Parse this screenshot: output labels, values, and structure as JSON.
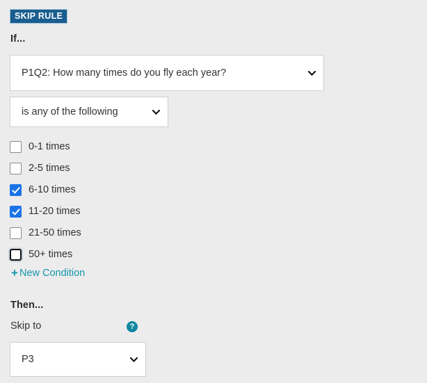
{
  "badge": {
    "label": "SKIP RULE",
    "bg_color": "#1a5e8f",
    "text_color": "#ffffff"
  },
  "if_section": {
    "heading": "If...",
    "question_select": {
      "value": "P1Q2: How many times do you fly each year?",
      "chevron_icon": "chevron-down-icon"
    },
    "operator_select": {
      "value": "is any of the following",
      "chevron_icon": "chevron-down-icon"
    },
    "choices": [
      {
        "label": "0-1 times",
        "checked": false,
        "focused": false
      },
      {
        "label": "2-5 times",
        "checked": false,
        "focused": false
      },
      {
        "label": "6-10 times",
        "checked": true,
        "focused": false
      },
      {
        "label": "11-20 times",
        "checked": true,
        "focused": false
      },
      {
        "label": "21-50 times",
        "checked": false,
        "focused": false
      },
      {
        "label": "50+ times",
        "checked": false,
        "focused": true
      }
    ],
    "new_condition": {
      "label": "New Condition",
      "plus_icon": "plus-icon",
      "color": "#1597ad"
    }
  },
  "then_section": {
    "heading": "Then...",
    "skip_to_label": "Skip to",
    "help_icon": {
      "glyph": "?",
      "name": "help-circle-icon",
      "color": "#10889e"
    },
    "skipto_select": {
      "value": "P3",
      "chevron_icon": "chevron-down-icon"
    }
  },
  "theme": {
    "page_background": "#ececec",
    "checkbox_checked_color": "#1a73e8",
    "link_color": "#1597ad",
    "text_color": "#333333"
  }
}
